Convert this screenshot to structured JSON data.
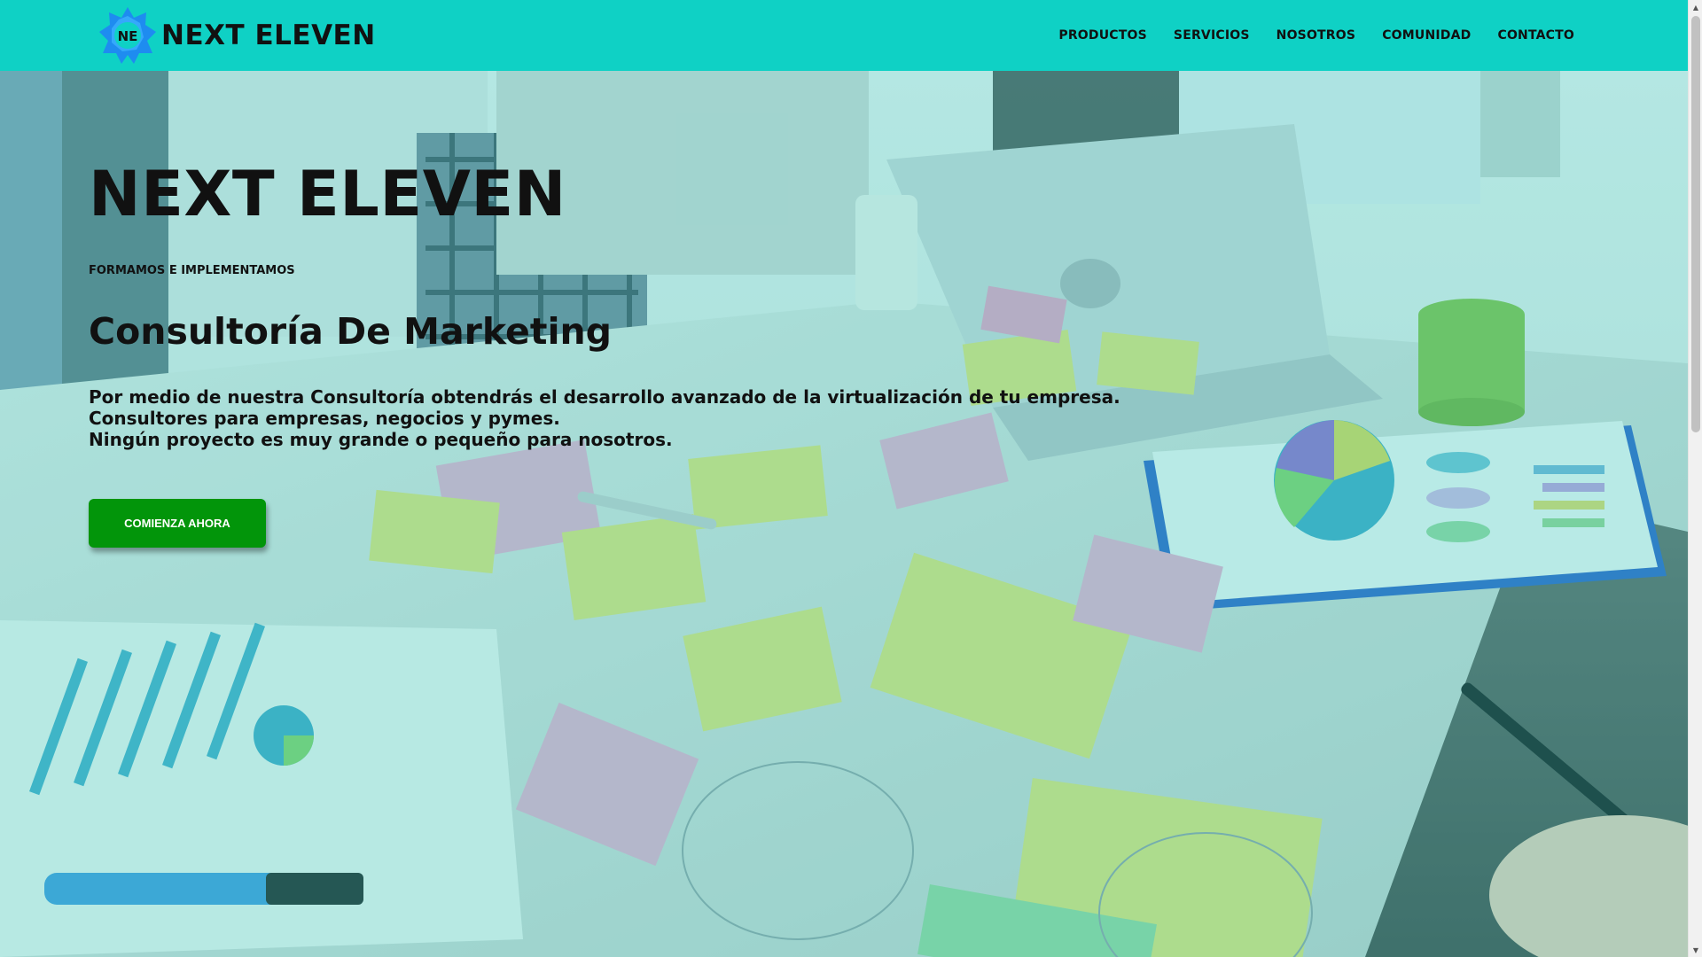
{
  "header": {
    "brand_name": "NEXT ELEVEN",
    "logo_initials": "NE",
    "nav": [
      {
        "label": "PRODUCTOS"
      },
      {
        "label": "SERVICIOS"
      },
      {
        "label": "NOSOTROS"
      },
      {
        "label": "COMUNIDAD"
      },
      {
        "label": "CONTACTO"
      }
    ]
  },
  "hero": {
    "title": "NEXT ELEVEN",
    "kicker": "FORMAMOS E IMPLEMENTAMOS",
    "subtitle": "Consultoría De Marketing",
    "description": [
      "Por medio de nuestra Consultoría obtendrás el desarrollo avanzado de la virtualización de tu empresa.",
      "Consultores para empresas, negocios y pymes.",
      "Ningún proyecto es muy grande o pequeño para nosotros."
    ],
    "cta_label": "COMIENZA AHORA"
  },
  "scrollbar": {
    "up_arrow": "▲",
    "down_arrow": "▼"
  },
  "colors": {
    "header_bg": "#0fd1c5",
    "cta_bg": "#02950a",
    "logo_blue": "#1e8cf0",
    "text": "#111111"
  },
  "icons": {
    "logo": "hexagonal-star-logo"
  }
}
